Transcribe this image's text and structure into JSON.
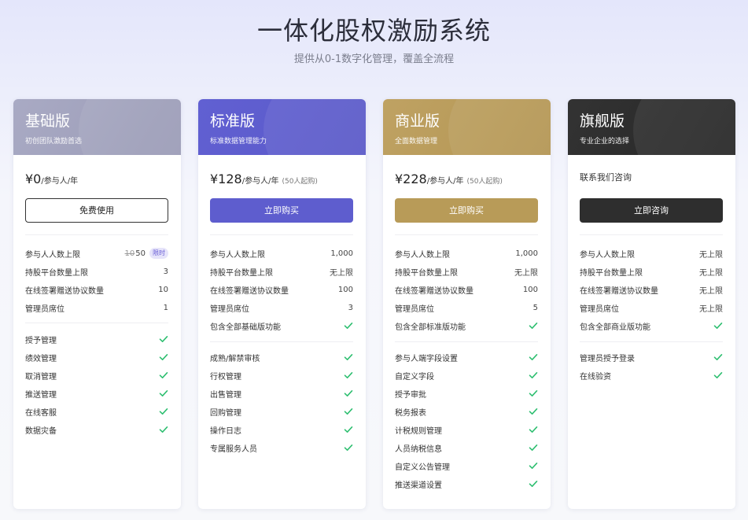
{
  "hero": {
    "title": "一体化股权激励系统",
    "subtitle": "提供从0-1数字化管理，覆盖全流程"
  },
  "colors": {
    "check": "#2fbf71",
    "basic_header": "#a2a3bd",
    "standard_header": "#5e5dce",
    "business_header": "#b89b58",
    "flagship_header": "#2e2e2e"
  },
  "plans": [
    {
      "id": "basic",
      "title": "基础版",
      "tagline": "初创团队激励首选",
      "price": "¥0",
      "unit": "/参与人/年",
      "note": "",
      "cta": "免费使用",
      "limits": [
        {
          "label": "参与人人数上限",
          "value": "50",
          "old_value": "10",
          "badge": "限时"
        },
        {
          "label": "持股平台数量上限",
          "value": "3"
        },
        {
          "label": "在线签署赠送协议数量",
          "value": "10"
        },
        {
          "label": "管理员席位",
          "value": "1"
        }
      ],
      "features": [
        "授予管理",
        "绩效管理",
        "取消管理",
        "推送管理",
        "在线客服",
        "数据灾备"
      ]
    },
    {
      "id": "standard",
      "title": "标准版",
      "tagline": "标准数据管理能力",
      "price": "¥128",
      "unit": "/参与人/年",
      "note": "(50人起购)",
      "cta": "立即购买",
      "limits": [
        {
          "label": "参与人人数上限",
          "value": "1,000"
        },
        {
          "label": "持股平台数量上限",
          "value": "无上限"
        },
        {
          "label": "在线签署赠送协议数量",
          "value": "100"
        },
        {
          "label": "管理员席位",
          "value": "3"
        },
        {
          "label": "包含全部基础版功能",
          "value": ""
        }
      ],
      "features": [
        "成熟/解禁审核",
        "行权管理",
        "出售管理",
        "回购管理",
        "操作日志",
        "专属服务人员"
      ]
    },
    {
      "id": "business",
      "title": "商业版",
      "tagline": "全面数据管理",
      "price": "¥228",
      "unit": "/参与人/年",
      "note": "(50人起购)",
      "cta": "立即购买",
      "limits": [
        {
          "label": "参与人人数上限",
          "value": "1,000"
        },
        {
          "label": "持股平台数量上限",
          "value": "无上限"
        },
        {
          "label": "在线签署赠送协议数量",
          "value": "100"
        },
        {
          "label": "管理员席位",
          "value": "5"
        },
        {
          "label": "包含全部标准版功能",
          "value": ""
        }
      ],
      "features": [
        "参与人端字段设置",
        "自定义字段",
        "授予审批",
        "税务报表",
        "计税规则管理",
        "人员纳税信息",
        "自定义公告管理",
        "推送渠道设置"
      ]
    },
    {
      "id": "flagship",
      "title": "旗舰版",
      "tagline": "专业企业的选择",
      "contact": "联系我们咨询",
      "cta": "立即咨询",
      "limits": [
        {
          "label": "参与人人数上限",
          "value": "无上限"
        },
        {
          "label": "持股平台数量上限",
          "value": "无上限"
        },
        {
          "label": "在线签署赠送协议数量",
          "value": "无上限"
        },
        {
          "label": "管理员席位",
          "value": "无上限"
        },
        {
          "label": "包含全部商业版功能",
          "value": ""
        }
      ],
      "features": [
        "管理员授予登录",
        "在线验资"
      ]
    }
  ]
}
